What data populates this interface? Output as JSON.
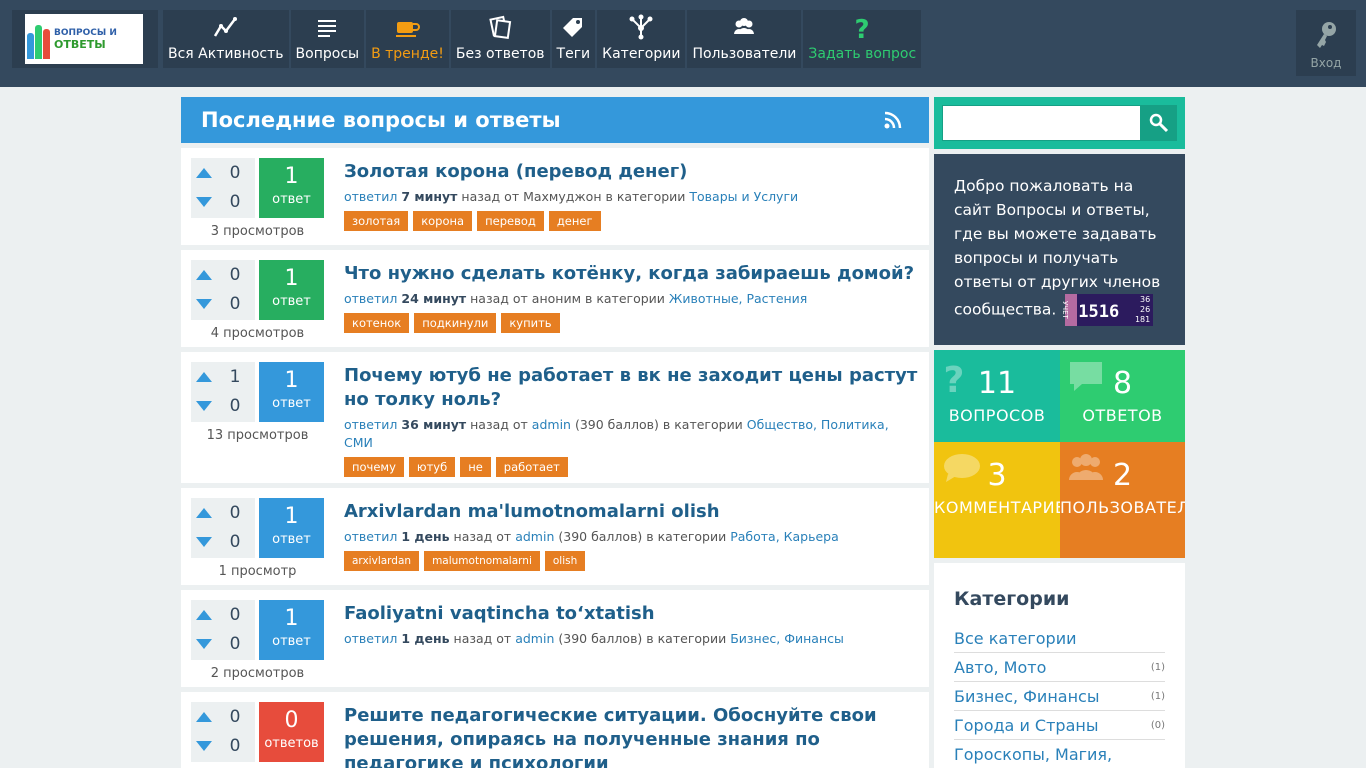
{
  "header": {
    "logo": {
      "line1": "ВОПРОСЫ И",
      "line2": "ОТВЕТЫ"
    },
    "nav": [
      {
        "label": "Вся Активность",
        "icon": "activity-icon"
      },
      {
        "label": "Вопросы",
        "icon": "list-icon"
      },
      {
        "label": "В тренде!",
        "icon": "coffee-cup-icon"
      },
      {
        "label": "Без ответов",
        "icon": "papers-icon"
      },
      {
        "label": "Теги",
        "icon": "tag-icon"
      },
      {
        "label": "Категории",
        "icon": "hierarchy-icon"
      },
      {
        "label": "Пользователи",
        "icon": "users-icon"
      },
      {
        "label": "Задать вопрос",
        "icon": "question-mark-icon"
      }
    ],
    "login_label": "Вход"
  },
  "main": {
    "title": "Последние вопросы и ответы",
    "questions": [
      {
        "up": "0",
        "down": "0",
        "answers": "1",
        "answers_label": "ответ",
        "answer_color": "#27ae60",
        "views": "3 просмотров",
        "title": "Золотая корона (перевод денег)",
        "meta": {
          "action": "ответил",
          "time": "7 минут",
          "ago": "назад от",
          "user": "Махмуджон",
          "points": "",
          "in_cat": "в категории",
          "category": "Товары и Услуги"
        },
        "tags": [
          "золотая",
          "корона",
          "перевод",
          "денег"
        ]
      },
      {
        "up": "0",
        "down": "0",
        "answers": "1",
        "answers_label": "ответ",
        "answer_color": "#27ae60",
        "views": "4 просмотров",
        "title": "Что нужно сделать котёнку, когда забираешь домой?",
        "meta": {
          "action": "ответил",
          "time": "24 минут",
          "ago": "назад от",
          "user": "аноним",
          "points": "",
          "in_cat": "в категории",
          "category": "Животные, Растения"
        },
        "tags": [
          "котенок",
          "подкинули",
          "купить"
        ]
      },
      {
        "up": "1",
        "down": "0",
        "answers": "1",
        "answers_label": "ответ",
        "answer_color": "#3498db",
        "views": "13 просмотров",
        "title": "Почему ютуб не работает в вк не заходит цены растут но толку ноль?",
        "meta": {
          "action": "ответил",
          "time": "36 минут",
          "ago": "назад от",
          "user": "admin",
          "points": "(390 баллов)",
          "in_cat": "в категории",
          "category": "Общество, Политика, СМИ"
        },
        "tags": [
          "почему",
          "ютуб",
          "не",
          "работает"
        ]
      },
      {
        "up": "0",
        "down": "0",
        "answers": "1",
        "answers_label": "ответ",
        "answer_color": "#3498db",
        "views": "1 просмотр",
        "title": "Arxivlardan ma'lumotnomalarni olish",
        "meta": {
          "action": "ответил",
          "time": "1 день",
          "ago": "назад от",
          "user": "admin",
          "points": "(390 баллов)",
          "in_cat": "в категории",
          "category": "Работа, Карьера"
        },
        "tags": [
          "arxivlardan",
          "malumotnomalarni",
          "olish"
        ]
      },
      {
        "up": "0",
        "down": "0",
        "answers": "1",
        "answers_label": "ответ",
        "answer_color": "#3498db",
        "views": "2 просмотров",
        "title": "Faoliyatni vaqtincha to‘xtatish",
        "meta": {
          "action": "ответил",
          "time": "1 день",
          "ago": "назад от",
          "user": "admin",
          "points": "(390 баллов)",
          "in_cat": "в категории",
          "category": "Бизнес, Финансы"
        },
        "tags": []
      },
      {
        "up": "0",
        "down": "0",
        "answers": "0",
        "answers_label": "ответов",
        "answer_color": "#e74c3c",
        "views": "",
        "title": "Решите педагогические ситуации. Обоснуйте свои решения, опираясь на полученные знания по педагогике и психологии",
        "meta": null,
        "tags": []
      }
    ]
  },
  "sidebar": {
    "search": {
      "value": "",
      "placeholder": ""
    },
    "welcome": "Добро пожаловать на сайт Вопросы и ответы, где вы можете задавать вопросы и получать ответы от других членов сообщества.",
    "counter": {
      "side": "УЧЕТ",
      "big": "1516",
      "small": [
        "36",
        "26",
        "181"
      ]
    },
    "stats": [
      {
        "num": "11",
        "label": "ВОПРОСОВ",
        "color": "#1abc9c",
        "icon": "question-icon"
      },
      {
        "num": "8",
        "label": "ОТВЕТОВ",
        "color": "#2ecc71",
        "icon": "speech-bubble-icon"
      },
      {
        "num": "3",
        "label": "КОММЕНТАРИЕВ",
        "color": "#f1c40f",
        "icon": "comment-icon"
      },
      {
        "num": "2",
        "label": "ПОЛЬЗОВАТЕЛЕЙ",
        "color": "#e67e22",
        "icon": "users-icon"
      }
    ],
    "categories": {
      "title": "Категории",
      "items": [
        {
          "name": "Все категории",
          "count": ""
        },
        {
          "name": "Авто, Мото",
          "count": "(1)"
        },
        {
          "name": "Бизнес, Финансы",
          "count": "(1)"
        },
        {
          "name": "Города и Страны",
          "count": "(0)"
        },
        {
          "name": "Гороскопы, Магия,",
          "count": ""
        }
      ]
    }
  }
}
